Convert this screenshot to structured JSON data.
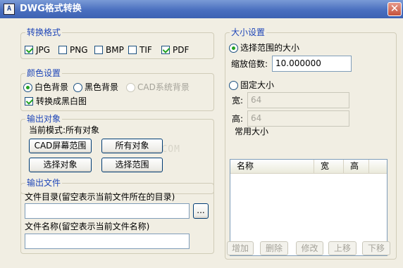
{
  "window": {
    "title": "DWG格式转换",
    "icon_text": "A",
    "close_label": "✕"
  },
  "format_group": {
    "legend": "转换格式",
    "options": [
      {
        "label": "JPG",
        "checked": true
      },
      {
        "label": "PNG",
        "checked": false
      },
      {
        "label": "BMP",
        "checked": false
      },
      {
        "label": "TIF",
        "checked": false
      },
      {
        "label": "PDF",
        "checked": true
      }
    ]
  },
  "color_group": {
    "legend": "颜色设置",
    "radios": [
      {
        "label": "白色背景",
        "checked": true,
        "enabled": true
      },
      {
        "label": "黑色背景",
        "checked": false,
        "enabled": true
      },
      {
        "label": "CAD系统背景",
        "checked": false,
        "enabled": false
      }
    ],
    "bw_checkbox": {
      "label": "转换成黑白图",
      "checked": true
    }
  },
  "output_object": {
    "legend": "输出对象",
    "mode_text": "当前模式:所有对象",
    "buttons": {
      "cad_screen": "CAD屏幕范围",
      "all_objects": "所有对象",
      "select_objects": "选择对象",
      "select_range": "选择范围"
    }
  },
  "watermark": "WWW.9UPK.COM",
  "output_file": {
    "legend": "输出文件",
    "dir_label": "文件目录(留空表示当前文件所在的目录)",
    "dir_value": "",
    "browse_label": "...",
    "name_label": "文件名称(留空表示当前文件名称)",
    "name_value": ""
  },
  "size_group": {
    "legend": "大小设置",
    "radio_range": {
      "label": "选择范围的大小",
      "checked": true
    },
    "scale_label": "缩放倍数:",
    "scale_value": "10.000000",
    "radio_fixed": {
      "label": "固定大小",
      "checked": false
    },
    "width_label": "宽:",
    "width_value": "64",
    "height_label": "高:",
    "height_value": "64",
    "common_label": "常用大小",
    "list_columns": [
      "名称",
      "宽",
      "高"
    ],
    "list_rows": [],
    "buttons": {
      "add": "增加",
      "delete": "删除",
      "modify": "修改",
      "up": "上移",
      "down": "下移"
    }
  }
}
